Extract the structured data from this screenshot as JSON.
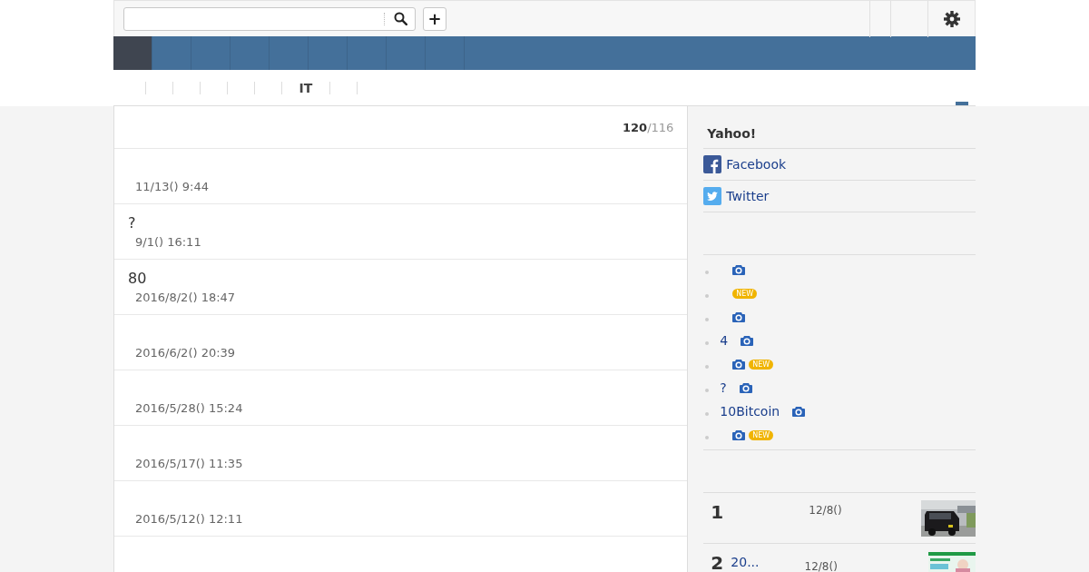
{
  "header": {
    "add_button": "+"
  },
  "nav": {
    "tabs": [
      {
        "selected": true
      },
      {
        "selected": false
      },
      {
        "selected": false
      },
      {
        "selected": false
      },
      {
        "selected": false
      },
      {
        "selected": false
      },
      {
        "selected": false
      },
      {
        "selected": false
      },
      {
        "selected": false
      }
    ]
  },
  "subnav": {
    "items": [
      {
        "kind": "blank"
      },
      {
        "kind": "blank"
      },
      {
        "kind": "blank"
      },
      {
        "kind": "blank"
      },
      {
        "kind": "blank"
      },
      {
        "kind": "label",
        "label": "IT"
      },
      {
        "kind": "blank"
      },
      {
        "kind": "blank"
      }
    ]
  },
  "main": {
    "count": "120",
    "total": "/116",
    "rows": [
      {
        "date": "11/13() 9:44"
      },
      {
        "title": "?",
        "date": "9/1() 16:11"
      },
      {
        "title": "80",
        "date": "2016/8/2() 18:47"
      },
      {
        "date": "2016/6/2() 20:39"
      },
      {
        "date": "2016/5/28() 15:24"
      },
      {
        "date": "2016/5/17() 11:35"
      },
      {
        "date": "2016/5/12() 12:11"
      }
    ]
  },
  "sidebar": {
    "title": "Yahoo!",
    "share": [
      {
        "kind": "facebook",
        "label": "Facebook"
      },
      {
        "kind": "twitter",
        "label": "Twitter"
      }
    ],
    "links": [
      {
        "camera": true
      },
      {
        "camera": false,
        "badge": "NEW"
      },
      {
        "camera": true
      },
      {
        "title": "4",
        "camera": true
      },
      {
        "camera": true,
        "badge": "NEW"
      },
      {
        "title": "?",
        "camera": true
      },
      {
        "title": "10Bitcoin",
        "camera": true
      },
      {
        "camera": true,
        "badge": "NEW"
      }
    ],
    "ranking": [
      {
        "rank": "1",
        "date": "12/8()"
      },
      {
        "rank": "2",
        "title": "20...",
        "date": "12/8()"
      }
    ]
  }
}
